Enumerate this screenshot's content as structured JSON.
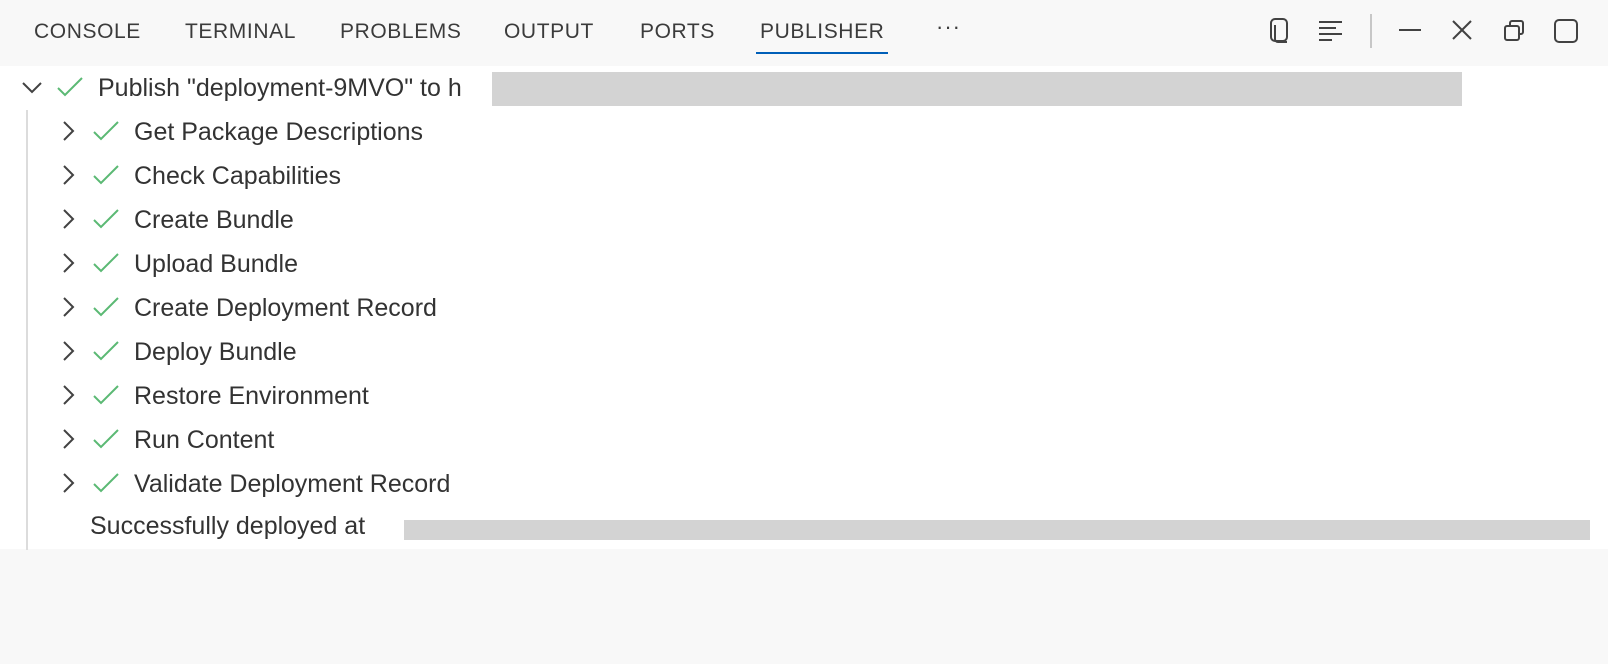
{
  "tabs": [
    {
      "label": "CONSOLE",
      "active": false
    },
    {
      "label": "TERMINAL",
      "active": false
    },
    {
      "label": "PROBLEMS",
      "active": false
    },
    {
      "label": "OUTPUT",
      "active": false
    },
    {
      "label": "PORTS",
      "active": false
    },
    {
      "label": "PUBLISHER",
      "active": true
    }
  ],
  "more_label": "···",
  "actions": [
    "copy-icon",
    "word-wrap-icon",
    "minimize-icon",
    "close-icon",
    "restore-icon",
    "maximize-icon"
  ],
  "colors": {
    "accent": "#005fb8",
    "success": "#5bb974",
    "redaction": "#d3d3d3"
  },
  "root": {
    "label": "Publish \"deployment-9MVO\" to h",
    "status_icon": "check-icon",
    "expanded": true
  },
  "steps": [
    {
      "label": "Get Package Descriptions",
      "status_icon": "check-icon"
    },
    {
      "label": "Check Capabilities",
      "status_icon": "check-icon"
    },
    {
      "label": "Create Bundle",
      "status_icon": "check-icon"
    },
    {
      "label": "Upload Bundle",
      "status_icon": "check-icon"
    },
    {
      "label": "Create Deployment Record",
      "status_icon": "check-icon"
    },
    {
      "label": "Deploy Bundle",
      "status_icon": "check-icon"
    },
    {
      "label": "Restore Environment",
      "status_icon": "check-icon"
    },
    {
      "label": "Run Content",
      "status_icon": "check-icon"
    },
    {
      "label": "Validate Deployment Record",
      "status_icon": "check-icon"
    }
  ],
  "result_message": "Successfully deployed at"
}
